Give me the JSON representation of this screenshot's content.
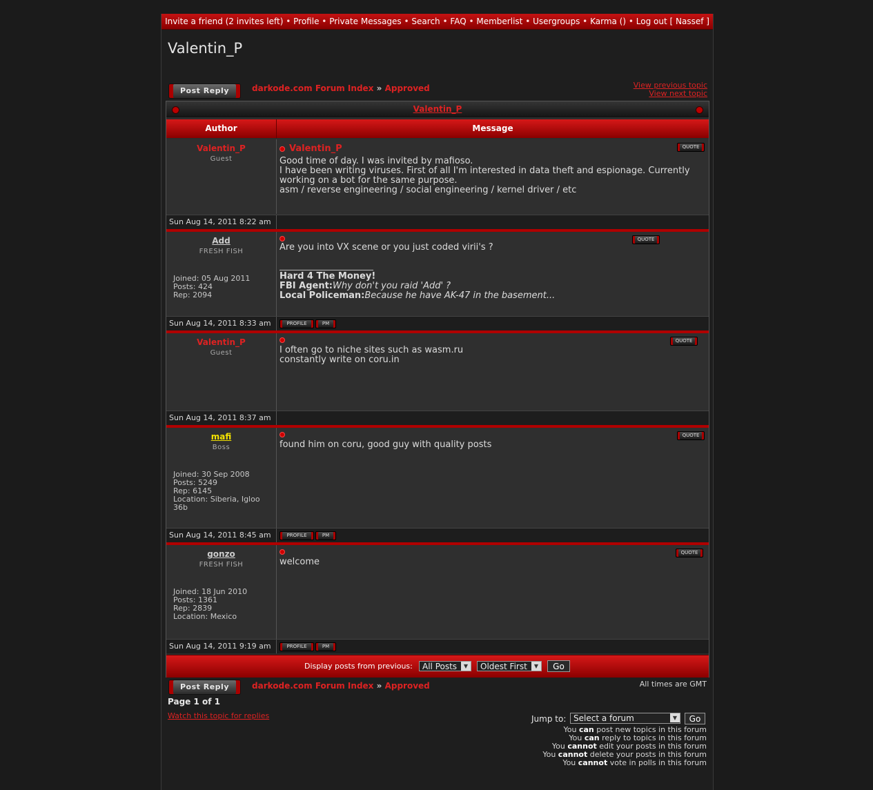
{
  "topnav": {
    "invite": "Invite a friend (2 invites left)",
    "profile": "Profile",
    "pm": "Private Messages",
    "search": "Search",
    "faq": "FAQ",
    "memberlist": "Memberlist",
    "usergroups": "Usergroups",
    "karma": "Karma ()",
    "logout": "Log out [ Nassef ]",
    "sep": "•"
  },
  "page_title": "Valentin_P",
  "post_reply": "Post Reply",
  "breadcrumb": {
    "index": "darkode.com Forum Index",
    "sep": "»",
    "forum": "Approved"
  },
  "topic_nav": {
    "prev": "View previous topic",
    "next": "View next topic"
  },
  "topic_title": "Valentin_P",
  "headers": {
    "author": "Author",
    "message": "Message"
  },
  "buttons": {
    "quote": "QUOTE",
    "profile": "PROFILE",
    "pm": "PM"
  },
  "posts": [
    {
      "author": "Valentin_P",
      "rank": "Guest",
      "subject": "Valentin_P",
      "lines": [
        "Good time of day. I was invited by mafioso.",
        "I have been writing viruses. First of all I'm interested in data theft and espionage. Currently",
        "working on a bot for the same purpose.",
        "asm / reverse engineering / social engineering / kernel driver / etc"
      ],
      "date": "Sun Aug 14, 2011 8:22 am"
    },
    {
      "author": "Add",
      "rank": "FRESH FISH",
      "joined": "Joined: 05 Aug 2011",
      "posts": "Posts: 424",
      "rep": "Rep: 2094",
      "lines": [
        "Are you into VX scene or you just coded virii's ?"
      ],
      "sig": {
        "title": "Hard 4 The Money!",
        "l1_label": "FBI Agent:",
        "l1_text": "Why don't you raid 'Add' ?",
        "l2_label": "Local Policeman:",
        "l2_text": "Because he have AK-47 in the basement..."
      },
      "date": "Sun Aug 14, 2011 8:33 am"
    },
    {
      "author": "Valentin_P",
      "rank": "Guest",
      "lines": [
        "I often go to niche sites such as wasm.ru",
        "constantly write on coru.in"
      ],
      "date": "Sun Aug 14, 2011 8:37 am"
    },
    {
      "author": "mafi",
      "rank": "Boss",
      "joined": "Joined: 30 Sep 2008",
      "posts": "Posts: 5249",
      "rep": "Rep: 6145",
      "location": "Location: Siberia, Igloo 36b",
      "lines": [
        "found him on coru, good guy with quality posts"
      ],
      "date": "Sun Aug 14, 2011 8:45 am"
    },
    {
      "author": "gonzo",
      "rank": "FRESH FISH",
      "joined": "Joined: 18 Jun 2010",
      "posts": "Posts: 1361",
      "rep": "Rep: 2839",
      "location": "Location: Mexico",
      "lines": [
        "welcome"
      ],
      "date": "Sun Aug 14, 2011 9:19 am"
    }
  ],
  "display": {
    "label": "Display posts from previous:",
    "posts_sel": "All Posts",
    "order_sel": "Oldest First",
    "go": "Go"
  },
  "timezone": "All times are GMT",
  "page_of": "Page 1 of 1",
  "watch": "Watch this topic for replies",
  "jump": {
    "label": "Jump to:",
    "select": "Select a forum",
    "go": "Go"
  },
  "permissions": [
    {
      "pre": "You ",
      "em": "can",
      "post": " post new topics in this forum"
    },
    {
      "pre": "You ",
      "em": "can",
      "post": " reply to topics in this forum"
    },
    {
      "pre": "You ",
      "em": "cannot",
      "post": " edit your posts in this forum"
    },
    {
      "pre": "You ",
      "em": "cannot",
      "post": " delete your posts in this forum"
    },
    {
      "pre": "You ",
      "em": "cannot",
      "post": " vote in polls in this forum"
    }
  ],
  "colors": {
    "accent_red": "#c41212",
    "guest_name": "#dd2222",
    "boss_name": "#f4e300",
    "panel": "#2f2f2f"
  }
}
